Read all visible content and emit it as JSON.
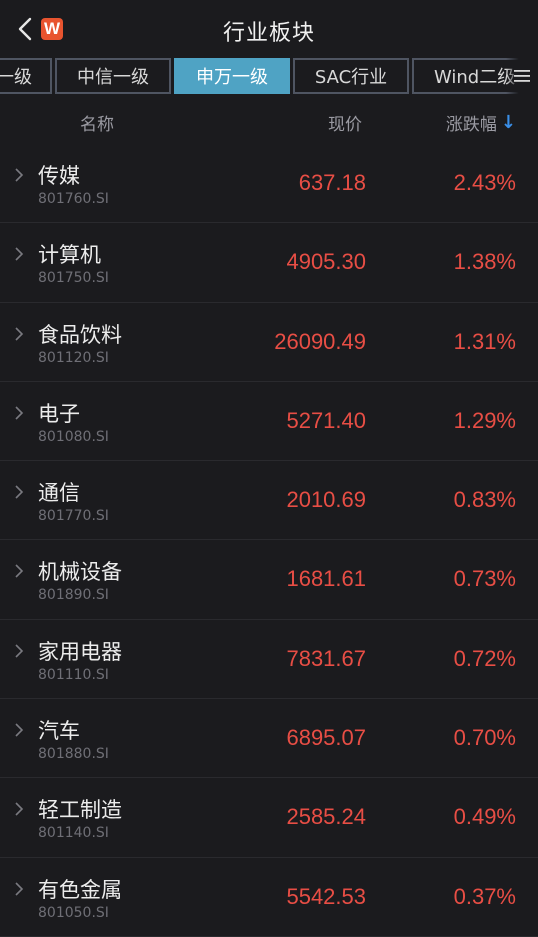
{
  "header": {
    "title": "行业板块",
    "logo_text": "W"
  },
  "tabs": [
    {
      "label": "一级"
    },
    {
      "label": "中信一级"
    },
    {
      "label": "申万一级"
    },
    {
      "label": "SAC行业"
    },
    {
      "label": "Wind二级"
    }
  ],
  "active_tab": "申万一级",
  "columns": {
    "name": "名称",
    "price": "现价",
    "change": "涨跌幅",
    "sort_indicator": "↓"
  },
  "colors": {
    "accent_tab": "#4fa3c4",
    "up": "#e84e45",
    "sort": "#3a8fe8"
  },
  "rows": [
    {
      "name": "传媒",
      "code": "801760.SI",
      "price": "637.18",
      "change": "2.43%"
    },
    {
      "name": "计算机",
      "code": "801750.SI",
      "price": "4905.30",
      "change": "1.38%"
    },
    {
      "name": "食品饮料",
      "code": "801120.SI",
      "price": "26090.49",
      "change": "1.31%"
    },
    {
      "name": "电子",
      "code": "801080.SI",
      "price": "5271.40",
      "change": "1.29%"
    },
    {
      "name": "通信",
      "code": "801770.SI",
      "price": "2010.69",
      "change": "0.83%"
    },
    {
      "name": "机械设备",
      "code": "801890.SI",
      "price": "1681.61",
      "change": "0.73%"
    },
    {
      "name": "家用电器",
      "code": "801110.SI",
      "price": "7831.67",
      "change": "0.72%"
    },
    {
      "name": "汽车",
      "code": "801880.SI",
      "price": "6895.07",
      "change": "0.70%"
    },
    {
      "name": "轻工制造",
      "code": "801140.SI",
      "price": "2585.24",
      "change": "0.49%"
    },
    {
      "name": "有色金属",
      "code": "801050.SI",
      "price": "5542.53",
      "change": "0.37%"
    }
  ]
}
